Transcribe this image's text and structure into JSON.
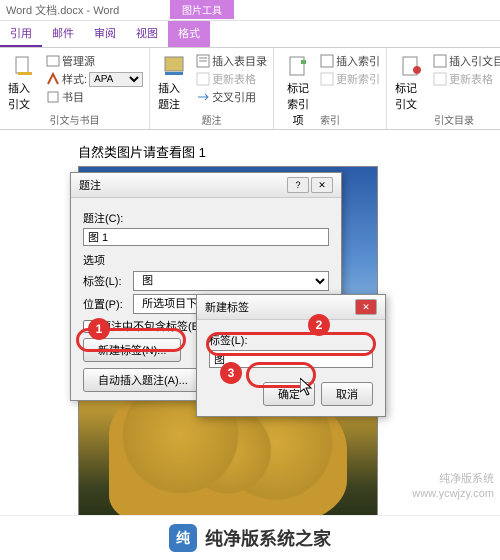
{
  "window": {
    "title": "Word 文档.docx - Word",
    "context_tab": "图片工具"
  },
  "tabs": {
    "t1": "引用",
    "t2": "邮件",
    "t3": "审阅",
    "t4": "视图",
    "t5": "格式"
  },
  "ribbon": {
    "g1": {
      "big": "插入引文",
      "r1": "管理源",
      "r2_label": "样式:",
      "r2_value": "APA",
      "r3": "书目",
      "label": "引文与书目"
    },
    "g2": {
      "big": "插入题注",
      "r1": "插入表目录",
      "r2": "更新表格",
      "r3": "交叉引用",
      "label": "题注"
    },
    "g3": {
      "big": "标记索引项",
      "r1": "插入索引",
      "r2": "更新索引",
      "label": "索引"
    },
    "g4": {
      "big": "标记引文",
      "r1": "插入引文目录",
      "r2": "更新表格",
      "label": "引文目录"
    }
  },
  "doc": {
    "caption": "自然类图片请查看图 1"
  },
  "dlg_caption": {
    "title": "题注",
    "help": "?",
    "close": "✕",
    "label_caption": "题注(C):",
    "caption_value": "图 1",
    "options_label": "选项",
    "label_tag": "标签(L):",
    "tag_value": "图",
    "label_pos": "位置(P):",
    "pos_value": "所选项目下方",
    "chk_exclude": "题注中不包含标签(E)",
    "btn_new": "新建标签(N)...",
    "btn_auto": "自动插入题注(A)..."
  },
  "dlg_new": {
    "title": "新建标签",
    "close": "✕",
    "label": "标签(L):",
    "value": "图",
    "ok": "确定",
    "cancel": "取消"
  },
  "annot": {
    "n1": "1",
    "n2": "2",
    "n3": "3"
  },
  "wm": {
    "l1": "纯净版系统",
    "l2": "www.ycwjzy.com"
  },
  "footer": {
    "text": "纯净版系统之家"
  }
}
